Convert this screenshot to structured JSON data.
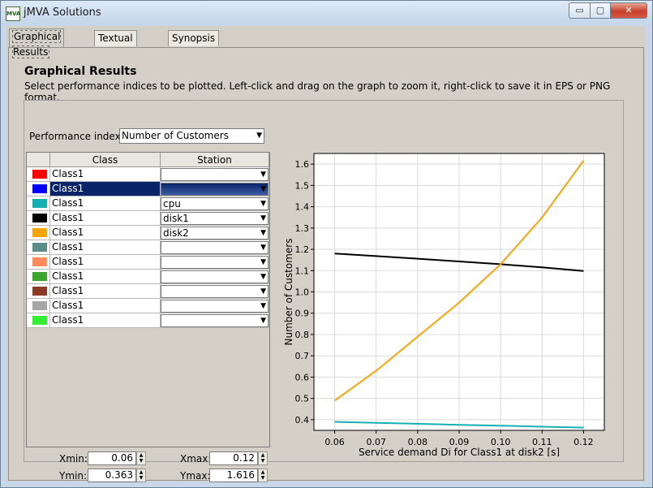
{
  "window": {
    "title": "jMVA Solutions",
    "icon_text": "MVA",
    "min_glyph": "▭",
    "max_glyph": "▢",
    "close_glyph": "✕"
  },
  "tabs": [
    {
      "label": "Graphical Results",
      "active": true
    },
    {
      "label": "Textual Results",
      "active": false
    },
    {
      "label": "Synopsis",
      "active": false
    }
  ],
  "panel": {
    "title": "Graphical Results",
    "description": "Select performance indices to be plotted. Left-click and drag on the graph to zoom it, right-click to save it in EPS or PNG format."
  },
  "performance_index": {
    "label": "Performance index:",
    "value": "Number of Customers"
  },
  "table": {
    "headers": {
      "class": "Class",
      "station": "Station"
    },
    "rows": [
      {
        "color": "#ff0000",
        "class": "Class1",
        "station": "",
        "selected": false
      },
      {
        "color": "#0000ff",
        "class": "Class1",
        "station": "",
        "selected": true
      },
      {
        "color": "#16b0b3",
        "class": "Class1",
        "station": "cpu",
        "selected": false
      },
      {
        "color": "#000000",
        "class": "Class1",
        "station": "disk1",
        "selected": false
      },
      {
        "color": "#f5a40b",
        "class": "Class1",
        "station": "disk2",
        "selected": false
      },
      {
        "color": "#5c8c8a",
        "class": "Class1",
        "station": "",
        "selected": false
      },
      {
        "color": "#ff8a5c",
        "class": "Class1",
        "station": "",
        "selected": false
      },
      {
        "color": "#3aa62e",
        "class": "Class1",
        "station": "",
        "selected": false
      },
      {
        "color": "#8b3a26",
        "class": "Class1",
        "station": "",
        "selected": false
      },
      {
        "color": "#a6a6a6",
        "class": "Class1",
        "station": "",
        "selected": false
      },
      {
        "color": "#33ee33",
        "class": "Class1",
        "station": "",
        "selected": false
      }
    ]
  },
  "range": {
    "xmin_label": "Xmin:",
    "xmin": "0.06",
    "xmax_label": "Xmax:",
    "xmax": "0.12",
    "ymin_label": "Ymin:",
    "ymin": "0.363",
    "ymax_label": "Ymax:",
    "ymax": "1.616"
  },
  "chart_data": {
    "type": "line",
    "xlabel": "Service demand Di for Class1 at disk2 [s]",
    "ylabel": "Number of Customers",
    "xlim": [
      0.055,
      0.125
    ],
    "ylim": [
      0.35,
      1.65
    ],
    "grid": true,
    "x_ticks": [
      "0.06",
      "0.07",
      "0.08",
      "0.09",
      "0.10",
      "0.11",
      "0.12"
    ],
    "y_ticks": [
      "0.4",
      "0.5",
      "0.6",
      "0.7",
      "0.8",
      "0.9",
      "1.0",
      "1.1",
      "1.2",
      "1.3",
      "1.4",
      "1.5",
      "1.6"
    ],
    "series": [
      {
        "color": "#16b0b3",
        "x": [
          0.06,
          0.07,
          0.08,
          0.09,
          0.1,
          0.11,
          0.12
        ],
        "y": [
          0.39,
          0.385,
          0.381,
          0.376,
          0.372,
          0.367,
          0.363
        ]
      },
      {
        "color": "#000000",
        "x": [
          0.06,
          0.07,
          0.08,
          0.09,
          0.1,
          0.11,
          0.12
        ],
        "y": [
          1.18,
          1.168,
          1.156,
          1.143,
          1.13,
          1.115,
          1.098
        ]
      },
      {
        "color": "#f5a40b",
        "x": [
          0.06,
          0.07,
          0.08,
          0.09,
          0.1,
          0.11,
          0.12
        ],
        "y": [
          0.49,
          0.63,
          0.79,
          0.95,
          1.13,
          1.35,
          1.616
        ]
      }
    ]
  }
}
